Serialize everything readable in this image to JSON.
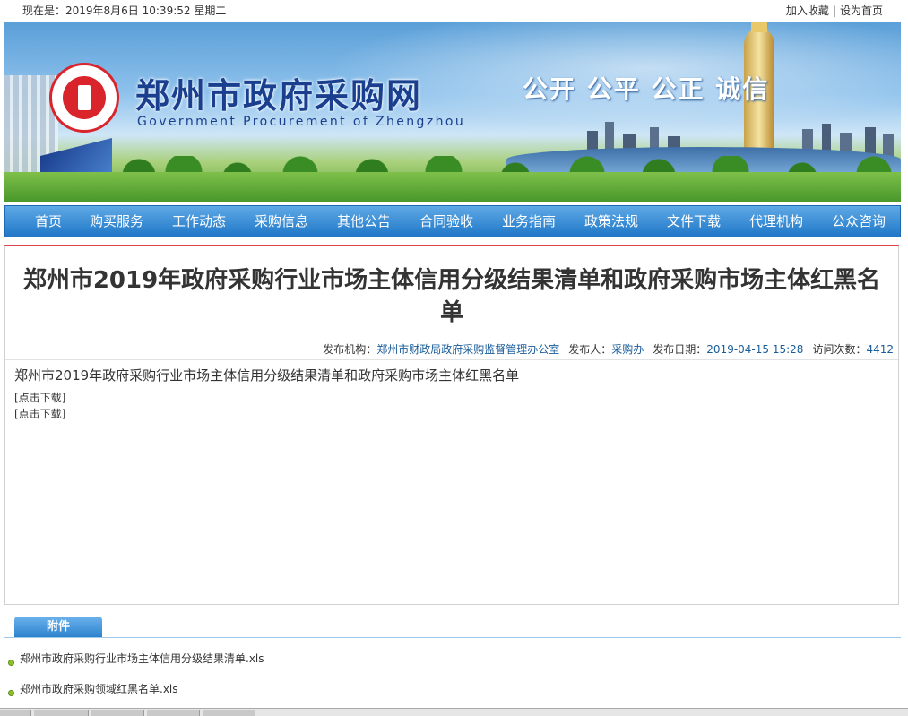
{
  "topbar": {
    "date": "现在是：2019年8月6日 10:39:52 星期二",
    "bookmark": "加入收藏",
    "separator": "|",
    "homepage": "设为首页"
  },
  "banner": {
    "site_name": "郑州市政府采购网",
    "site_name_en": "Government Procurement of Zhengzhou",
    "slogan": "公开 公平 公正 诚信"
  },
  "nav": {
    "items": [
      "首页",
      "购买服务",
      "工作动态",
      "采购信息",
      "其他公告",
      "合同验收",
      "业务指南",
      "政策法规",
      "文件下载",
      "代理机构",
      "公众咨询"
    ]
  },
  "article": {
    "title": "郑州市2019年政府采购行业市场主体信用分级结果清单和政府采购市场主体红黑名单",
    "meta": {
      "org_label": "发布机构：",
      "org": "郑州市财政局政府采购监督管理办公室",
      "publisher_label": "发布人：",
      "publisher": "采购办",
      "date_label": "发布日期：",
      "date": "2019-04-15 15:28",
      "visits_label": "访问次数：",
      "visits": "4412"
    },
    "body_text": "郑州市2019年政府采购行业市场主体信用分级结果清单和政府采购市场主体红黑名单",
    "downloads": [
      "[点击下载]",
      "[点击下载]"
    ]
  },
  "attachments": {
    "tab_label": "附件",
    "files": [
      "郑州市政府采购行业市场主体信用分级结果清单.xls",
      "郑州市政府采购领域红黑名单.xls"
    ]
  },
  "colors": {
    "nav_blue": "#1f77c7",
    "title_rule_red": "#e0434b",
    "meta_blue": "#1a5d9a",
    "brand_blue": "#1a3f8f"
  }
}
